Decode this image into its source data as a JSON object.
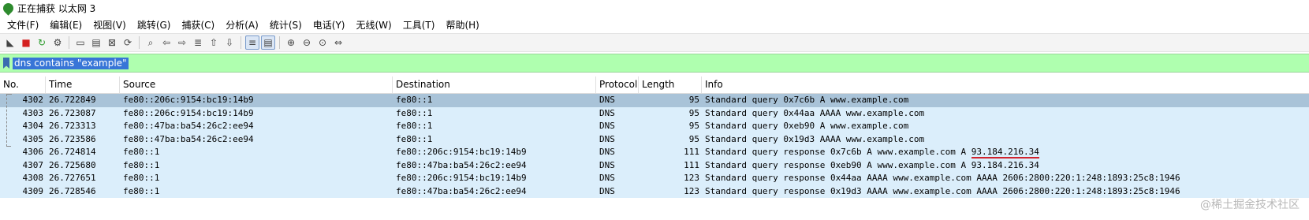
{
  "window": {
    "title": "正在捕获 以太网 3"
  },
  "menu": [
    "文件(F)",
    "编辑(E)",
    "视图(V)",
    "跳转(G)",
    "捕获(C)",
    "分析(A)",
    "统计(S)",
    "电话(Y)",
    "无线(W)",
    "工具(T)",
    "帮助(H)"
  ],
  "toolbar": {
    "icons": [
      "shark-fin-icon",
      "stop-capture-icon",
      "restart-capture-icon",
      "capture-options-icon",
      "open-file-icon",
      "save-file-icon",
      "close-file-icon",
      "reload-file-icon",
      "find-packet-icon",
      "go-back-icon",
      "go-forward-icon",
      "go-to-packet-icon",
      "go-first-icon",
      "go-last-icon",
      "auto-scroll-icon",
      "colorize-icon",
      "zoom-in-icon",
      "zoom-out-icon",
      "zoom-normal-icon",
      "resize-columns-icon"
    ],
    "glyphs": [
      "◣",
      "■",
      "↻",
      "⚙",
      "▭",
      "▤",
      "⊠",
      "⟳",
      "⌕",
      "⇦",
      "⇨",
      "≣",
      "⇧",
      "⇩",
      "≡",
      "▤",
      "⊕",
      "⊖",
      "⊙",
      "⇔"
    ]
  },
  "filter": {
    "value": "dns contains \"example\""
  },
  "columns": [
    "No.",
    "Time",
    "Source",
    "Destination",
    "Protocol",
    "Length",
    "Info"
  ],
  "packets": [
    {
      "no": "4302",
      "time": "26.722849",
      "source": "fe80::206c:9154:bc19:14b9",
      "destination": "fe80::1",
      "protocol": "DNS",
      "length": "95",
      "info": "Standard query 0x7c6b A www.example.com",
      "info_hl": ""
    },
    {
      "no": "4303",
      "time": "26.723087",
      "source": "fe80::206c:9154:bc19:14b9",
      "destination": "fe80::1",
      "protocol": "DNS",
      "length": "95",
      "info": "Standard query 0x44aa AAAA www.example.com",
      "info_hl": ""
    },
    {
      "no": "4304",
      "time": "26.723313",
      "source": "fe80::47ba:ba54:26c2:ee94",
      "destination": "fe80::1",
      "protocol": "DNS",
      "length": "95",
      "info": "Standard query 0xeb90 A www.example.com",
      "info_hl": ""
    },
    {
      "no": "4305",
      "time": "26.723586",
      "source": "fe80::47ba:ba54:26c2:ee94",
      "destination": "fe80::1",
      "protocol": "DNS",
      "length": "95",
      "info": "Standard query 0x19d3 AAAA www.example.com",
      "info_hl": ""
    },
    {
      "no": "4306",
      "time": "26.724814",
      "source": "fe80::1",
      "destination": "fe80::206c:9154:bc19:14b9",
      "protocol": "DNS",
      "length": "111",
      "info": "Standard query response 0x7c6b A www.example.com A ",
      "info_hl": "93.184.216.34"
    },
    {
      "no": "4307",
      "time": "26.725680",
      "source": "fe80::1",
      "destination": "fe80::47ba:ba54:26c2:ee94",
      "protocol": "DNS",
      "length": "111",
      "info": "Standard query response 0xeb90 A www.example.com A 93.184.216.34",
      "info_hl": ""
    },
    {
      "no": "4308",
      "time": "26.727651",
      "source": "fe80::1",
      "destination": "fe80::206c:9154:bc19:14b9",
      "protocol": "DNS",
      "length": "123",
      "info": "Standard query response 0x44aa AAAA www.example.com AAAA 2606:2800:220:1:248:1893:25c8:1946",
      "info_hl": ""
    },
    {
      "no": "4309",
      "time": "26.728546",
      "source": "fe80::1",
      "destination": "fe80::47ba:ba54:26c2:ee94",
      "protocol": "DNS",
      "length": "123",
      "info": "Standard query response 0x19d3 AAAA www.example.com AAAA 2606:2800:220:1:248:1893:25c8:1946",
      "info_hl": ""
    }
  ],
  "selected_row": 0,
  "watermark": "@稀土掘金技术社区"
}
